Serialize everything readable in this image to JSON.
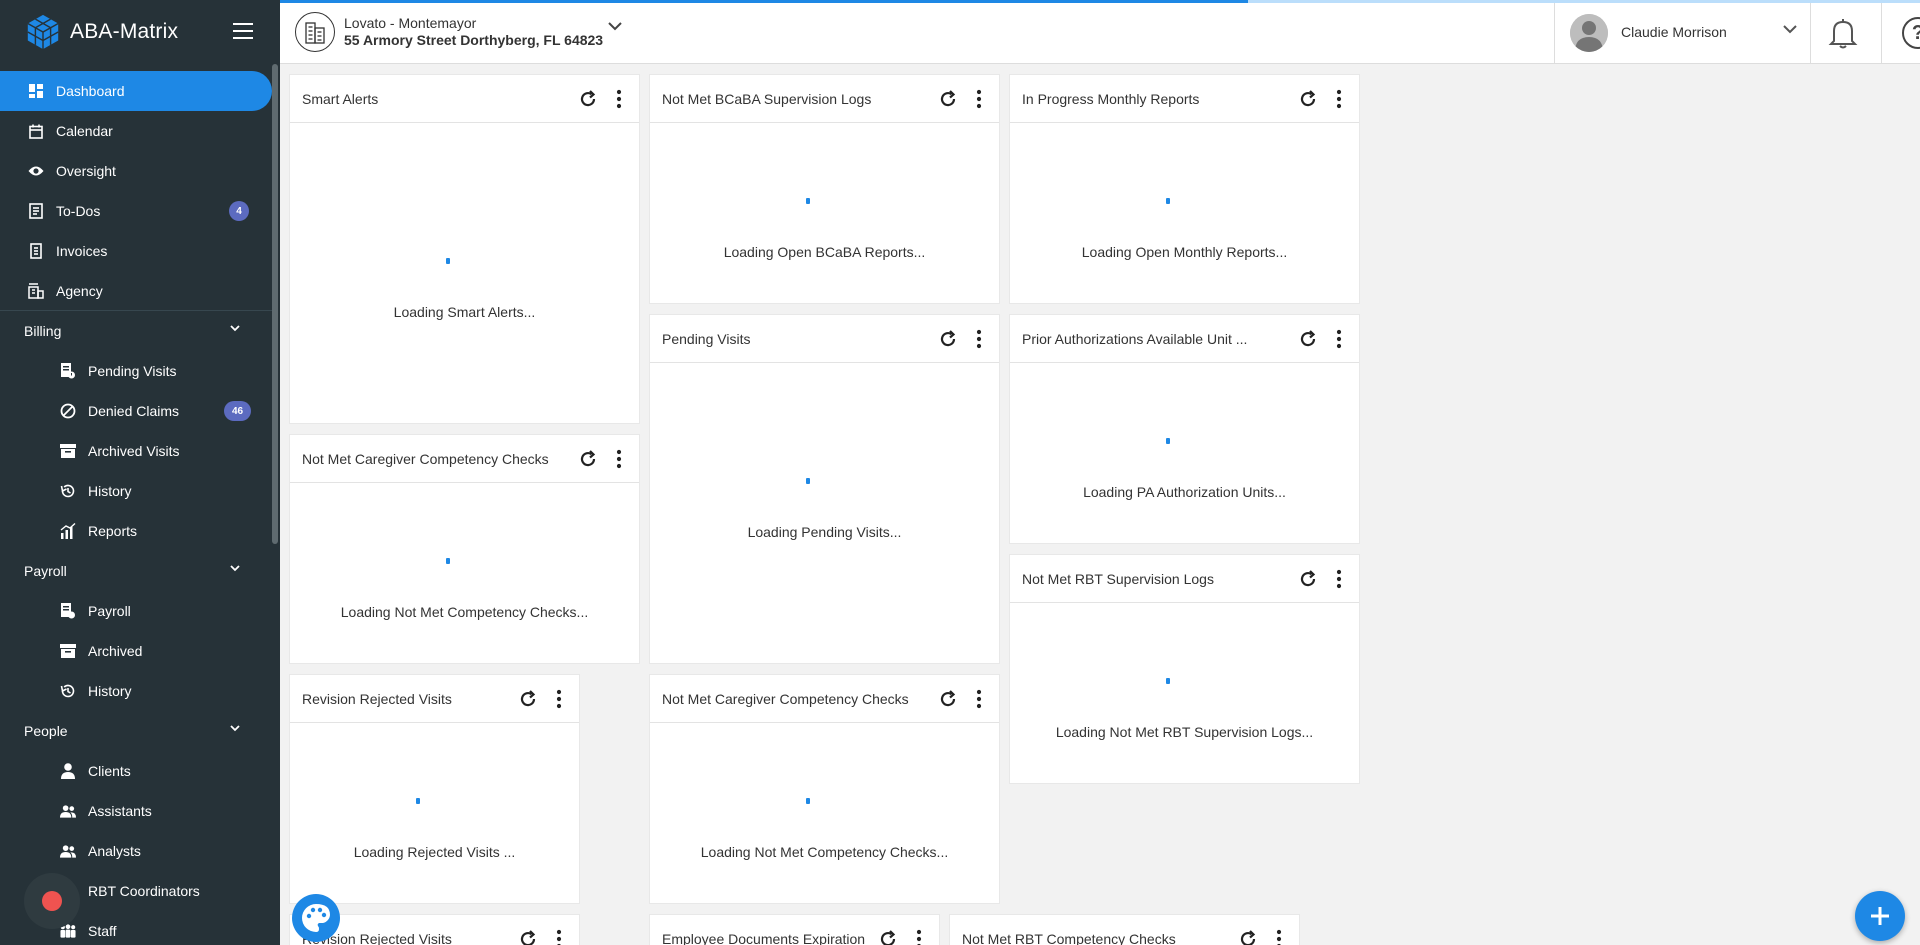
{
  "brand": {
    "name": "ABA-Matrix"
  },
  "header": {
    "agency_name": "Lovato - Montemayor",
    "agency_address": "55 Armory Street Dorthyberg, FL 64823",
    "user_name": "Claudie Morrison",
    "help_glyph": "?"
  },
  "nav": {
    "dashboard": "Dashboard",
    "calendar": "Calendar",
    "oversight": "Oversight",
    "todos": "To-Dos",
    "todos_badge": "4",
    "invoices": "Invoices",
    "agency": "Agency",
    "billing": "Billing",
    "pending_visits": "Pending Visits",
    "denied_claims": "Denied Claims",
    "denied_claims_badge": "46",
    "archived_visits": "Archived Visits",
    "billing_history": "History",
    "reports": "Reports",
    "payroll": "Payroll",
    "payroll_item": "Payroll",
    "payroll_archived": "Archived",
    "payroll_history": "History",
    "people": "People",
    "clients": "Clients",
    "assistants": "Assistants",
    "analysts": "Analysts",
    "rbt_coordinators": "RBT Coordinators",
    "staff": "Staff"
  },
  "widgets": {
    "smart_alerts": {
      "title": "Smart Alerts",
      "loading": "Loading Smart Alerts..."
    },
    "bcaba_logs": {
      "title": "Not Met BCaBA Supervision Logs",
      "loading": "Loading Open BCaBA Reports..."
    },
    "monthly_reports": {
      "title": "In Progress Monthly Reports",
      "loading": "Loading Open Monthly Reports..."
    },
    "pending_visits": {
      "title": "Pending Visits",
      "loading": "Loading Pending Visits..."
    },
    "prior_auth": {
      "title": "Prior Authorizations Available Unit ...",
      "loading": "Loading PA Authorization Units..."
    },
    "caregiver_checks_1": {
      "title": "Not Met Caregiver Competency Checks",
      "loading": "Loading Not Met Competency Checks..."
    },
    "rbt_logs": {
      "title": "Not Met RBT Supervision Logs",
      "loading": "Loading Not Met RBT Supervision Logs..."
    },
    "revision_rejected_1": {
      "title": "Revision Rejected Visits",
      "loading": "Loading Rejected Visits ..."
    },
    "caregiver_checks_2": {
      "title": "Not Met Caregiver Competency Checks",
      "loading": "Loading Not Met Competency Checks..."
    },
    "revision_rejected_2": {
      "title": "Revision Rejected Visits"
    },
    "employee_docs": {
      "title": "Employee Documents Expiration"
    },
    "rbt_competency": {
      "title": "Not Met RBT Competency Checks"
    }
  },
  "colors": {
    "sidebar": "#263238",
    "accent": "#1e88e5",
    "badge": "#5c6bc0"
  },
  "page_load_progress": 0.59
}
